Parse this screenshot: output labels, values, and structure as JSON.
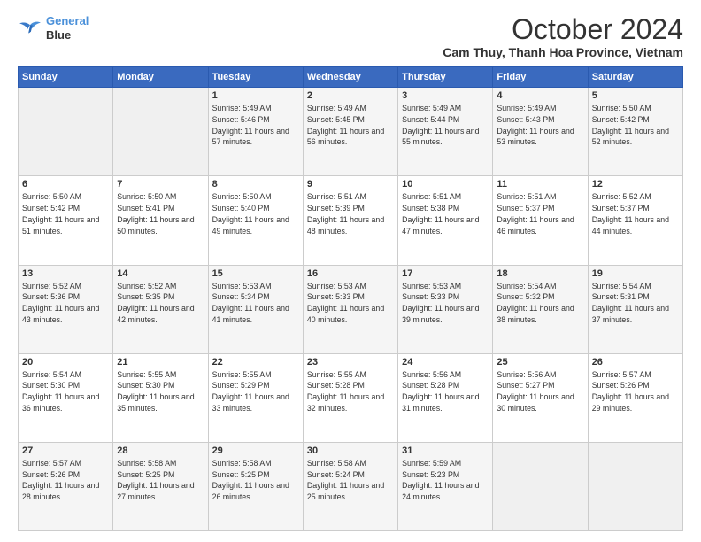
{
  "logo": {
    "line1": "General",
    "line2": "Blue"
  },
  "title": "October 2024",
  "location": "Cam Thuy, Thanh Hoa Province, Vietnam",
  "weekdays": [
    "Sunday",
    "Monday",
    "Tuesday",
    "Wednesday",
    "Thursday",
    "Friday",
    "Saturday"
  ],
  "weeks": [
    [
      {
        "day": null
      },
      {
        "day": null
      },
      {
        "day": 1,
        "sunrise": "5:49 AM",
        "sunset": "5:46 PM",
        "daylight": "11 hours and 57 minutes."
      },
      {
        "day": 2,
        "sunrise": "5:49 AM",
        "sunset": "5:45 PM",
        "daylight": "11 hours and 56 minutes."
      },
      {
        "day": 3,
        "sunrise": "5:49 AM",
        "sunset": "5:44 PM",
        "daylight": "11 hours and 55 minutes."
      },
      {
        "day": 4,
        "sunrise": "5:49 AM",
        "sunset": "5:43 PM",
        "daylight": "11 hours and 53 minutes."
      },
      {
        "day": 5,
        "sunrise": "5:50 AM",
        "sunset": "5:42 PM",
        "daylight": "11 hours and 52 minutes."
      }
    ],
    [
      {
        "day": 6,
        "sunrise": "5:50 AM",
        "sunset": "5:42 PM",
        "daylight": "11 hours and 51 minutes."
      },
      {
        "day": 7,
        "sunrise": "5:50 AM",
        "sunset": "5:41 PM",
        "daylight": "11 hours and 50 minutes."
      },
      {
        "day": 8,
        "sunrise": "5:50 AM",
        "sunset": "5:40 PM",
        "daylight": "11 hours and 49 minutes."
      },
      {
        "day": 9,
        "sunrise": "5:51 AM",
        "sunset": "5:39 PM",
        "daylight": "11 hours and 48 minutes."
      },
      {
        "day": 10,
        "sunrise": "5:51 AM",
        "sunset": "5:38 PM",
        "daylight": "11 hours and 47 minutes."
      },
      {
        "day": 11,
        "sunrise": "5:51 AM",
        "sunset": "5:37 PM",
        "daylight": "11 hours and 46 minutes."
      },
      {
        "day": 12,
        "sunrise": "5:52 AM",
        "sunset": "5:37 PM",
        "daylight": "11 hours and 44 minutes."
      }
    ],
    [
      {
        "day": 13,
        "sunrise": "5:52 AM",
        "sunset": "5:36 PM",
        "daylight": "11 hours and 43 minutes."
      },
      {
        "day": 14,
        "sunrise": "5:52 AM",
        "sunset": "5:35 PM",
        "daylight": "11 hours and 42 minutes."
      },
      {
        "day": 15,
        "sunrise": "5:53 AM",
        "sunset": "5:34 PM",
        "daylight": "11 hours and 41 minutes."
      },
      {
        "day": 16,
        "sunrise": "5:53 AM",
        "sunset": "5:33 PM",
        "daylight": "11 hours and 40 minutes."
      },
      {
        "day": 17,
        "sunrise": "5:53 AM",
        "sunset": "5:33 PM",
        "daylight": "11 hours and 39 minutes."
      },
      {
        "day": 18,
        "sunrise": "5:54 AM",
        "sunset": "5:32 PM",
        "daylight": "11 hours and 38 minutes."
      },
      {
        "day": 19,
        "sunrise": "5:54 AM",
        "sunset": "5:31 PM",
        "daylight": "11 hours and 37 minutes."
      }
    ],
    [
      {
        "day": 20,
        "sunrise": "5:54 AM",
        "sunset": "5:30 PM",
        "daylight": "11 hours and 36 minutes."
      },
      {
        "day": 21,
        "sunrise": "5:55 AM",
        "sunset": "5:30 PM",
        "daylight": "11 hours and 35 minutes."
      },
      {
        "day": 22,
        "sunrise": "5:55 AM",
        "sunset": "5:29 PM",
        "daylight": "11 hours and 33 minutes."
      },
      {
        "day": 23,
        "sunrise": "5:55 AM",
        "sunset": "5:28 PM",
        "daylight": "11 hours and 32 minutes."
      },
      {
        "day": 24,
        "sunrise": "5:56 AM",
        "sunset": "5:28 PM",
        "daylight": "11 hours and 31 minutes."
      },
      {
        "day": 25,
        "sunrise": "5:56 AM",
        "sunset": "5:27 PM",
        "daylight": "11 hours and 30 minutes."
      },
      {
        "day": 26,
        "sunrise": "5:57 AM",
        "sunset": "5:26 PM",
        "daylight": "11 hours and 29 minutes."
      }
    ],
    [
      {
        "day": 27,
        "sunrise": "5:57 AM",
        "sunset": "5:26 PM",
        "daylight": "11 hours and 28 minutes."
      },
      {
        "day": 28,
        "sunrise": "5:58 AM",
        "sunset": "5:25 PM",
        "daylight": "11 hours and 27 minutes."
      },
      {
        "day": 29,
        "sunrise": "5:58 AM",
        "sunset": "5:25 PM",
        "daylight": "11 hours and 26 minutes."
      },
      {
        "day": 30,
        "sunrise": "5:58 AM",
        "sunset": "5:24 PM",
        "daylight": "11 hours and 25 minutes."
      },
      {
        "day": 31,
        "sunrise": "5:59 AM",
        "sunset": "5:23 PM",
        "daylight": "11 hours and 24 minutes."
      },
      {
        "day": null
      },
      {
        "day": null
      }
    ]
  ],
  "labels": {
    "sunrise": "Sunrise:",
    "sunset": "Sunset:",
    "daylight": "Daylight:"
  }
}
